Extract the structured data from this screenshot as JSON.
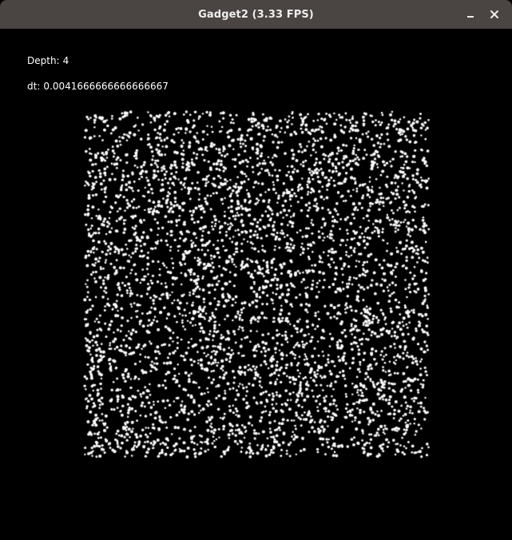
{
  "window": {
    "title": "Gadget2 (3.33 FPS)",
    "minimize_icon": "minimize-icon",
    "close_icon": "close-icon"
  },
  "overlay": {
    "depth_label": "Depth:",
    "depth_value": "4",
    "dt_label": "dt:",
    "dt_value": "0.0041666666666666667"
  },
  "colors": {
    "titlebar": "#4a4442",
    "background": "#000000",
    "text": "#ffffff",
    "particle": "#ffffff"
  }
}
